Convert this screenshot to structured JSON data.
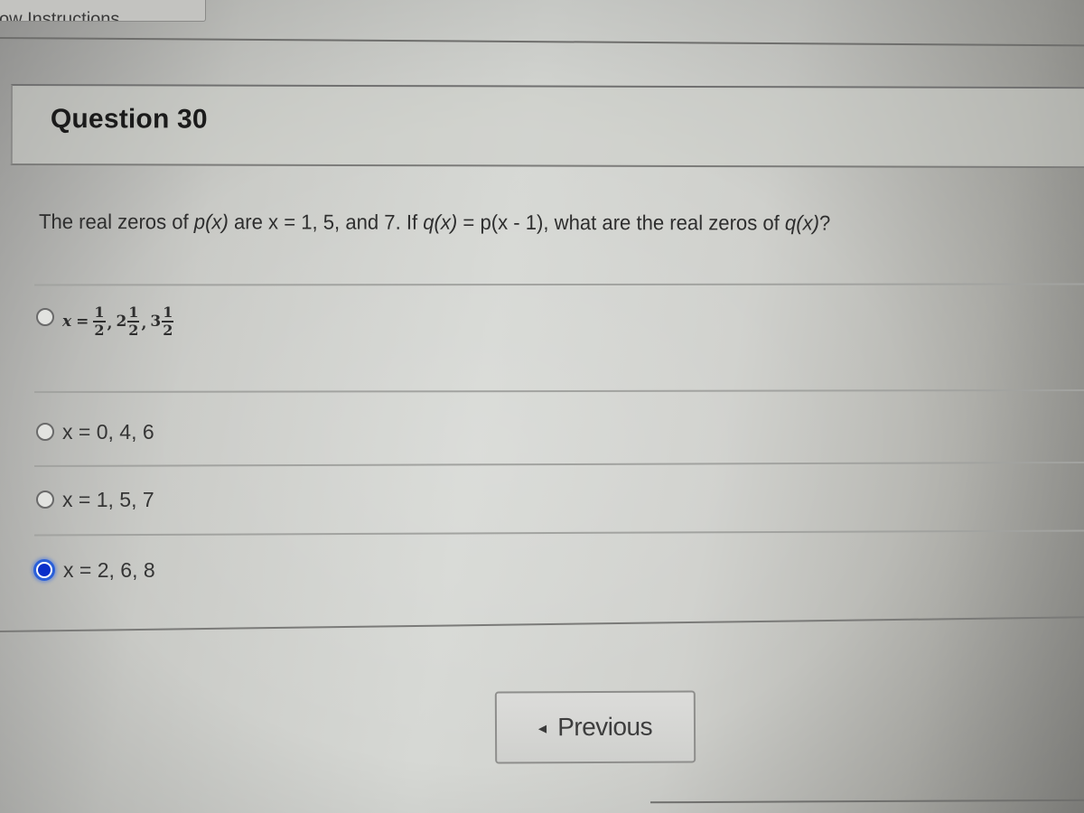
{
  "top_button": {
    "label_partial": "ow Instructions"
  },
  "question": {
    "title": "Question 30",
    "text_parts": {
      "p1": "The real zeros of ",
      "p_func": "p(x)",
      "p2": " are x = 1, 5, and 7.  If ",
      "q_func": "q(x)",
      "p3": " = p(x - 1), what are the real zeros of ",
      "q_func2": "q(x)",
      "p4": "?"
    }
  },
  "options": [
    {
      "id": "opt-1",
      "selected": false,
      "math": {
        "var": "x",
        "eq": "=",
        "terms": [
          {
            "whole": "",
            "num": "1",
            "den": "2"
          },
          {
            "whole": "2",
            "num": "1",
            "den": "2"
          },
          {
            "whole": "3",
            "num": "1",
            "den": "2"
          }
        ],
        "sep": ","
      },
      "plain_text": "x = 1/2, 2 1/2, 3 1/2"
    },
    {
      "id": "opt-2",
      "selected": false,
      "label": "x = 0, 4, 6"
    },
    {
      "id": "opt-3",
      "selected": false,
      "label": "x = 1, 5, 7"
    },
    {
      "id": "opt-4",
      "selected": true,
      "label": "x = 2, 6, 8"
    }
  ],
  "navigation": {
    "previous_label": "Previous",
    "previous_icon": "triangle-left-icon"
  },
  "colors": {
    "selected_radio": "#0a2fc9",
    "selected_ring": "#2a5fd8"
  }
}
